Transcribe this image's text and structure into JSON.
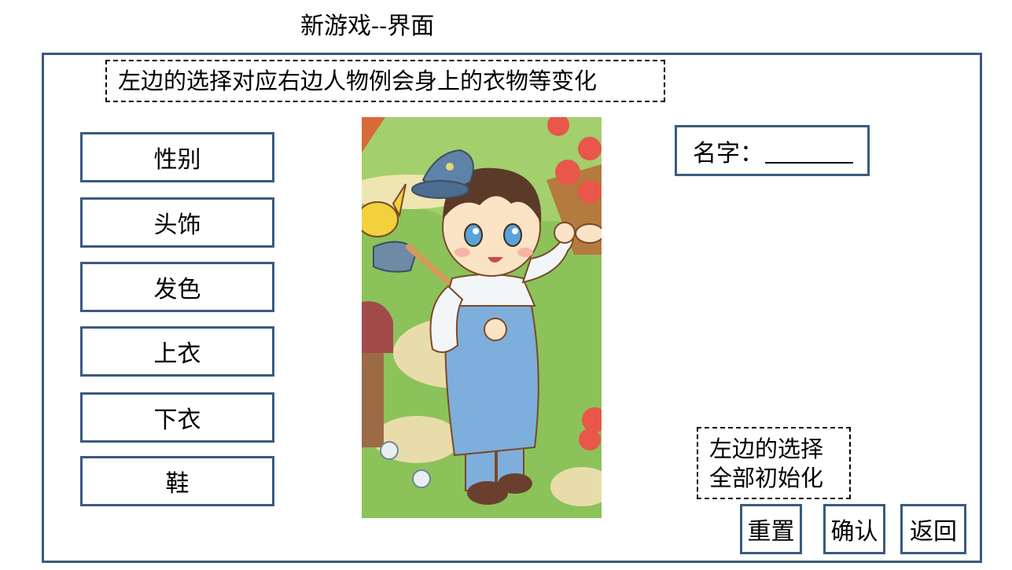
{
  "page_title": "新游戏--界面",
  "top_note": "左边的选择对应右边人物例会身上的衣物等变化",
  "options": [
    "性别",
    "头饰",
    "发色",
    "上衣",
    "下衣",
    "鞋"
  ],
  "name_field": {
    "label": "名字：",
    "value": ""
  },
  "reset_note": {
    "line1": "左边的选择",
    "line2": "全部初始化"
  },
  "actions": {
    "reset": "重置",
    "confirm": "确认",
    "back": "返回"
  },
  "character_icon": "character-preview-illustration",
  "colors": {
    "frame_border": "#3b5a7e",
    "preview_grass": "#8cc25a",
    "overalls": "#7eaedb",
    "apples": "#e8574a"
  }
}
